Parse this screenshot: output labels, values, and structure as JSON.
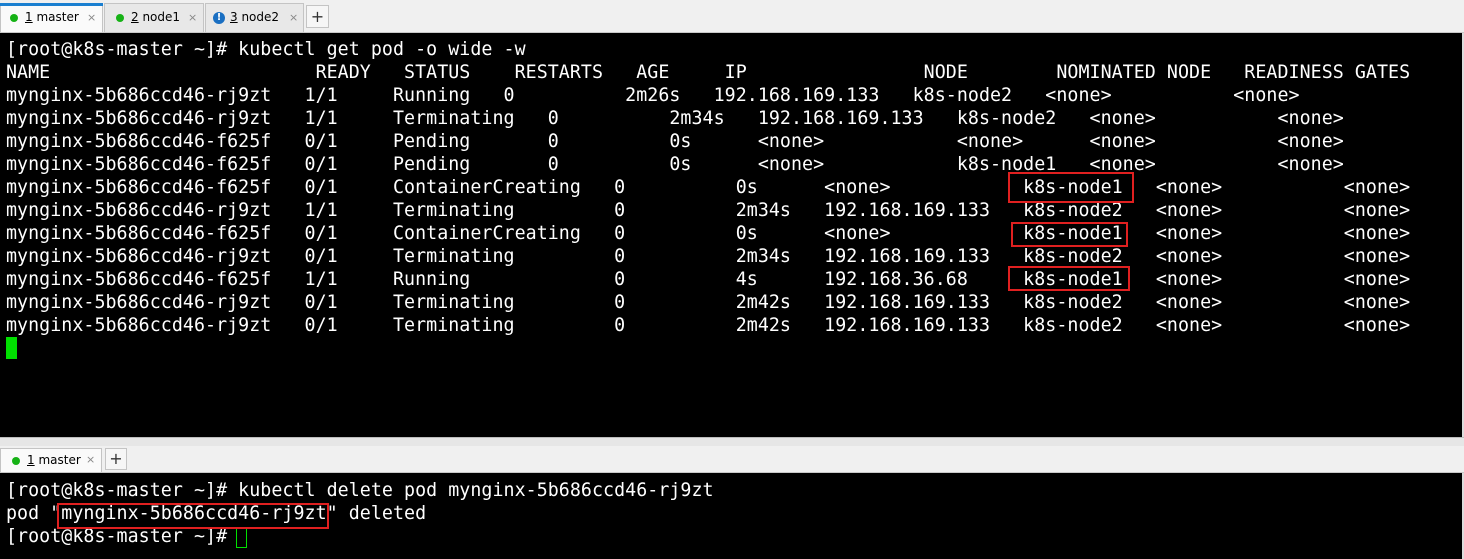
{
  "top_tabs": [
    {
      "num": "1",
      "name": " master",
      "status": "connected",
      "active": true
    },
    {
      "num": "2",
      "name": " node1",
      "status": "connected",
      "active": false
    },
    {
      "num": "3",
      "name": " node2",
      "status": "warning",
      "active": false
    }
  ],
  "bottom_tabs": [
    {
      "num": "1",
      "name": " master",
      "status": "connected",
      "active": true
    }
  ],
  "icons": {
    "close": "×",
    "add": "+",
    "warning": "!"
  },
  "colors": {
    "terminal_bg": "#000000",
    "text": "#ffffff",
    "cursor": "#00e000",
    "highlight": "#e02020",
    "tab_accent": "#1a7fd0",
    "connected": "#16b216"
  },
  "top_terminal": {
    "lines": [
      "[root@k8s-master ~]# kubectl get pod -o wide -w",
      "NAME                        READY   STATUS    RESTARTS   AGE     IP                NODE        NOMINATED NODE   READINESS GATES",
      "mynginx-5b686ccd46-rj9zt   1/1     Running   0          2m26s   192.168.169.133   k8s-node2   <none>           <none>",
      "mynginx-5b686ccd46-rj9zt   1/1     Terminating   0          2m34s   192.168.169.133   k8s-node2   <none>           <none>",
      "mynginx-5b686ccd46-f625f   0/1     Pending       0          0s      <none>            <none>      <none>           <none>",
      "mynginx-5b686ccd46-f625f   0/1     Pending       0          0s      <none>            k8s-node1   <none>           <none>",
      "mynginx-5b686ccd46-f625f   0/1     ContainerCreating   0          0s      <none>            k8s-node1   <none>           <none>",
      "mynginx-5b686ccd46-rj9zt   1/1     Terminating         0          2m34s   192.168.169.133   k8s-node2   <none>           <none>",
      "mynginx-5b686ccd46-f625f   0/1     ContainerCreating   0          0s      <none>            k8s-node1   <none>           <none>",
      "mynginx-5b686ccd46-rj9zt   0/1     Terminating         0          2m34s   192.168.169.133   k8s-node2   <none>           <none>",
      "mynginx-5b686ccd46-f625f   1/1     Running             0          4s      192.168.36.68     k8s-node1   <none>           <none>",
      "mynginx-5b686ccd46-rj9zt   0/1     Terminating         0          2m42s   192.168.169.133   k8s-node2   <none>           <none>",
      "mynginx-5b686ccd46-rj9zt   0/1     Terminating         0          2m42s   192.168.169.133   k8s-node2   <none>           <none>"
    ]
  },
  "bottom_terminal": {
    "lines": [
      "[root@k8s-master ~]# kubectl delete pod mynginx-5b686ccd46-rj9zt",
      "pod \"mynginx-5b686ccd46-rj9zt\" deleted",
      "[root@k8s-master ~]# "
    ]
  }
}
